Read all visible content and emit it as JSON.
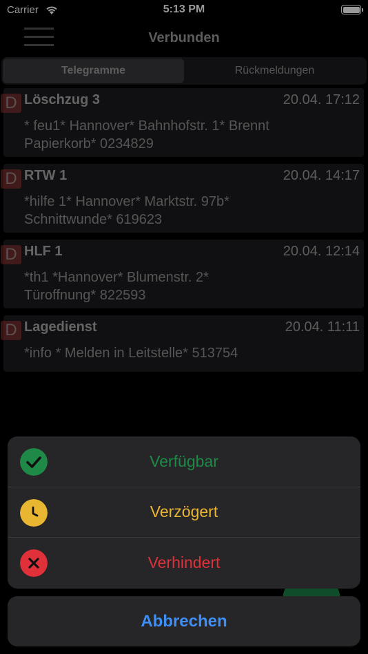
{
  "status": {
    "carrier": "Carrier",
    "time": "5:13 PM"
  },
  "nav": {
    "title": "Verbunden"
  },
  "tabs": [
    {
      "label": "Telegramme",
      "active": true
    },
    {
      "label": "Rückmeldungen",
      "active": false
    }
  ],
  "messages": [
    {
      "badge": "D",
      "title": "Löschzug 3",
      "time": "20.04. 17:12",
      "line1": "* feu1* Hannover* Bahnhofstr. 1* Brennt",
      "line2": "Papierkorb* 0234829"
    },
    {
      "badge": "D",
      "title": "RTW 1",
      "time": "20.04. 14:17",
      "line1": "*hilfe 1* Hannover* Marktstr. 97b*",
      "line2": "Schnittwunde* 619623"
    },
    {
      "badge": "D",
      "title": "HLF 1",
      "time": "20.04. 12:14",
      "line1": "*th1 *Hannover* Blumenstr. 2*",
      "line2": "Türoffnung* 822593"
    },
    {
      "badge": "D",
      "title": "Lagedienst",
      "time": "20.04. 11:11",
      "line1": "*info * Melden in Leitstelle* 513754",
      "line2": ""
    }
  ],
  "actions": [
    {
      "label": "Verfügbar",
      "icon": "checkmark-icon",
      "color": "#1f8a47"
    },
    {
      "label": "Verzögert",
      "icon": "clock-icon",
      "color": "#e9b632"
    },
    {
      "label": "Verhindert",
      "icon": "cross-icon",
      "color": "#e0303a"
    }
  ],
  "cancel": {
    "label": "Abbrechen",
    "color": "#3d8ef5"
  }
}
